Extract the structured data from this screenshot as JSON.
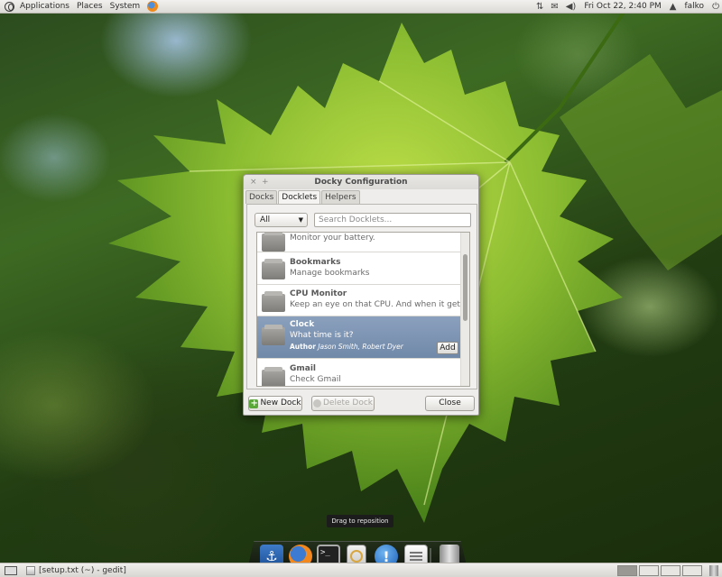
{
  "top_panel": {
    "menus": [
      "Applications",
      "Places",
      "System"
    ],
    "clock": "Fri Oct 22,  2:40 PM",
    "user": "falko"
  },
  "dialog": {
    "title": "Docky Configuration",
    "close_glyph": "×",
    "add_glyph": "+",
    "tabs": [
      "Docks",
      "Docklets",
      "Helpers"
    ],
    "active_tab": "Docklets",
    "filter": {
      "selected": "All",
      "arrow": "▼"
    },
    "search": {
      "placeholder": "Search Docklets..."
    },
    "docklets": [
      {
        "name": "",
        "description": "Monitor your battery."
      },
      {
        "name": "Bookmarks",
        "description": "Manage bookmarks"
      },
      {
        "name": "CPU Monitor",
        "description": "Keep an eye on that CPU. And when it gets o"
      },
      {
        "name": "Clock",
        "description": "What time is it?",
        "author_label": "Author",
        "author": "Jason Smith, Robert Dyer",
        "action": "Add",
        "selected": true
      },
      {
        "name": "Gmail",
        "description": "Check Gmail"
      }
    ],
    "buttons": {
      "new_dock": "New Dock",
      "delete_dock": "Delete Dock",
      "close": "Close"
    }
  },
  "tooltip": "Drag to reposition",
  "dock": {
    "items": [
      "anchor-icon",
      "firefox-icon",
      "terminal-icon",
      "ipod-icon",
      "notification-icon",
      "gedit-icon",
      "trash-icon"
    ],
    "terminal_text": ">_"
  },
  "bottom_panel": {
    "task": "[setup.txt (~) - gedit]"
  },
  "colors": {
    "selection": "#7a91b0",
    "panel": "#e8e6e2"
  }
}
